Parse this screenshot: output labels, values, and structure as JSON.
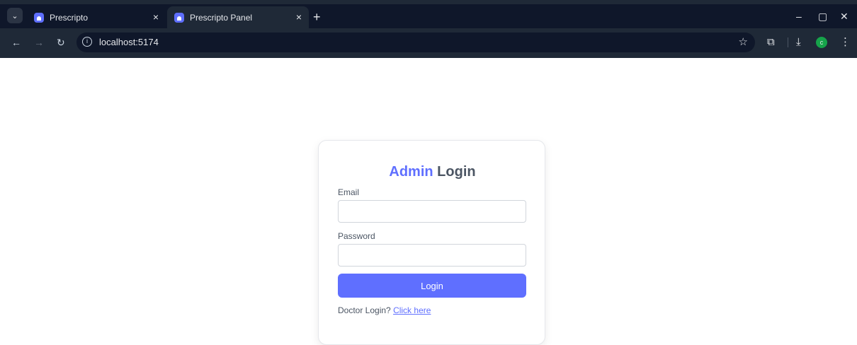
{
  "browser": {
    "tabs": [
      {
        "title": "Prescripto",
        "close": "×"
      },
      {
        "title": "Prescripto Panel",
        "close": "×"
      }
    ],
    "new_tab": "+",
    "window_controls": {
      "minimize": "–",
      "restore": "▢",
      "close": "✕"
    },
    "url": "localhost:5174",
    "profile_initial": "c",
    "icons": {
      "tab_search": "chevron-down-icon",
      "favicon": "prescripto-logo-icon",
      "back": "arrow-left-icon",
      "forward": "arrow-right-icon",
      "reload": "reload-icon",
      "site_info": "info-icon",
      "bookmark": "star-icon",
      "extensions": "puzzle-icon",
      "downloads": "download-icon",
      "menu": "kebab-menu-icon"
    }
  },
  "login": {
    "title_accent": "Admin",
    "title_rest": "Login",
    "email_label": "Email",
    "email_value": "",
    "password_label": "Password",
    "password_value": "",
    "button_label": "Login",
    "switch_prompt": "Doctor Login?",
    "switch_link": "Click here"
  },
  "colors": {
    "accent": "#5f6fff",
    "chrome_bg": "#1f2937",
    "tabstrip_bg": "#0f172a"
  }
}
